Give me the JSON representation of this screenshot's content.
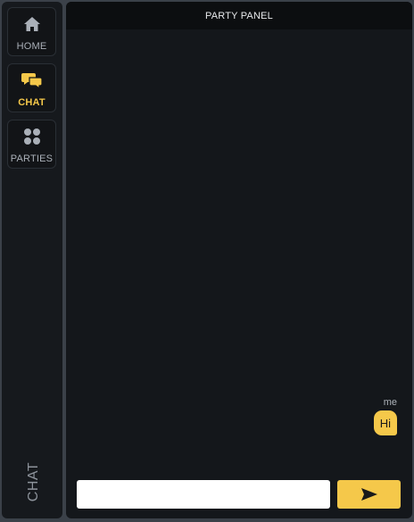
{
  "sidebar": {
    "items": [
      {
        "label": "HOME",
        "icon": "home-icon"
      },
      {
        "label": "CHAT",
        "icon": "chat-icon",
        "active": true
      },
      {
        "label": "PARTIES",
        "icon": "grid-icon"
      }
    ],
    "current_section": "CHAT"
  },
  "panel": {
    "title": "PARTY PANEL"
  },
  "messages": [
    {
      "author": "me",
      "text": "Hi"
    }
  ],
  "composer": {
    "value": "",
    "placeholder": "",
    "send_icon": "send-icon"
  },
  "colors": {
    "accent": "#f5c84a",
    "sidebar_bg": "#16191d",
    "panel_bg": "#14171b",
    "header_bg": "#0c0e10",
    "page_bg": "#3b4149"
  }
}
